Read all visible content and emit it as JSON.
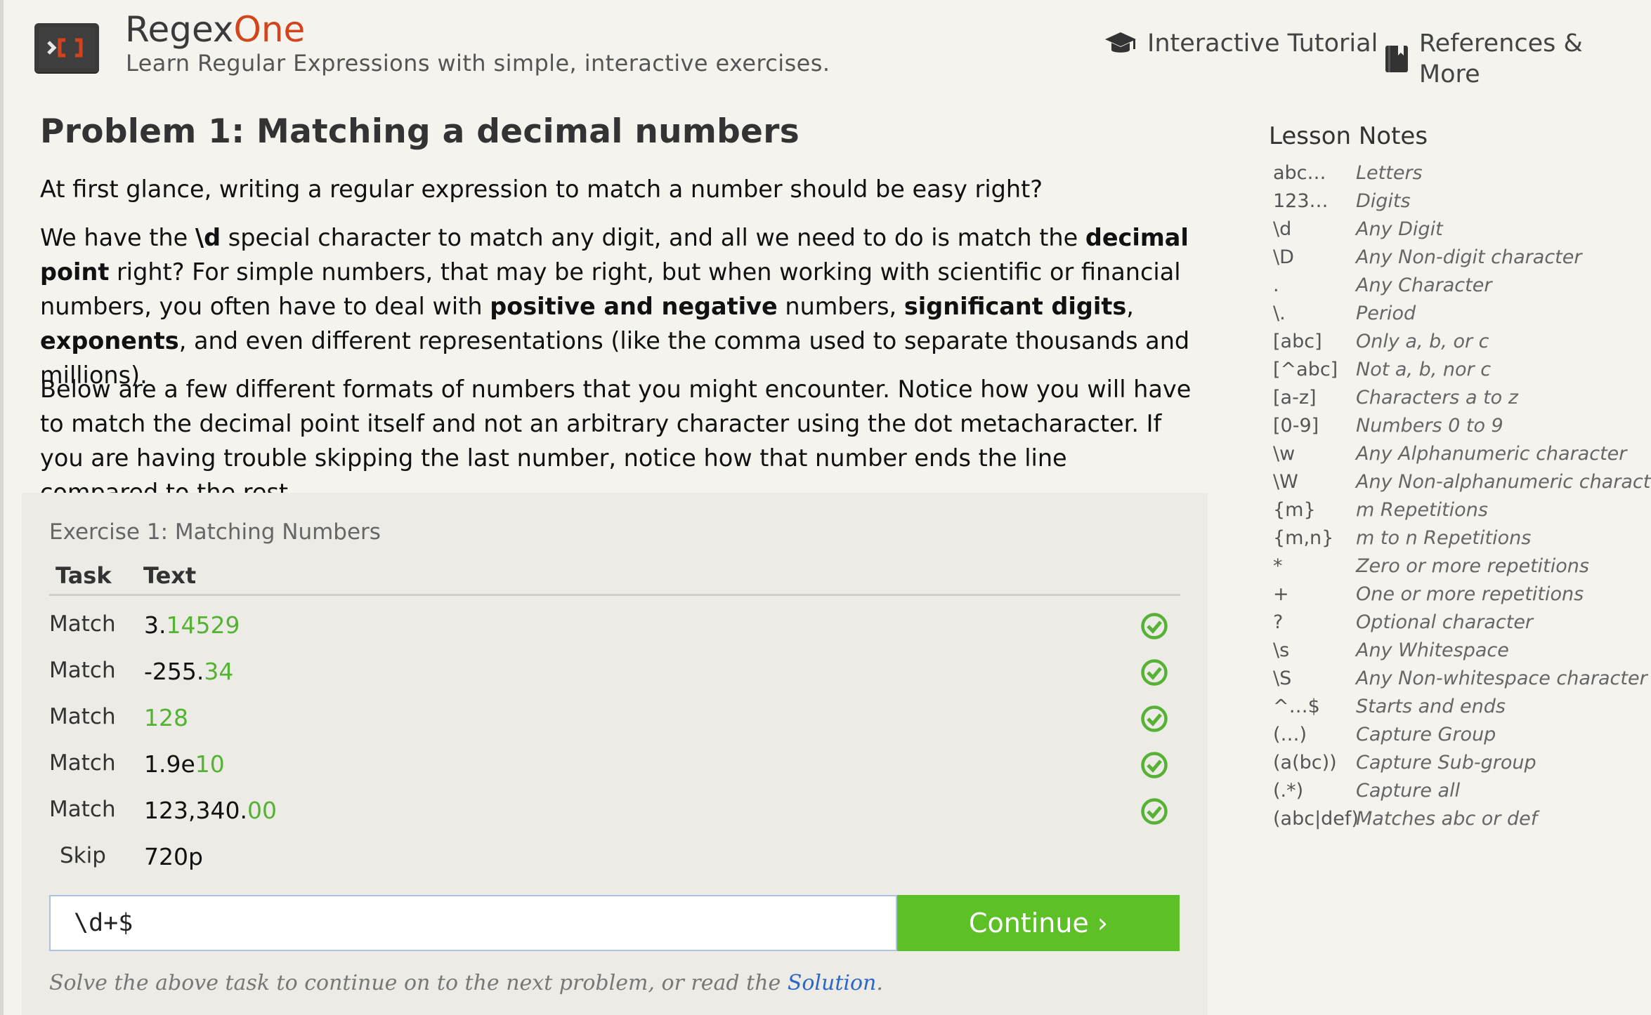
{
  "header": {
    "brand_main": "Regex",
    "brand_accent": "One",
    "tagline": "Learn Regular Expressions with simple, interactive exercises.",
    "nav": [
      {
        "label": "Interactive Tutorial",
        "icon": "graduation-cap-icon"
      },
      {
        "label": "References & More",
        "icon": "book-icon"
      }
    ]
  },
  "main": {
    "title": "Problem 1: Matching a decimal numbers",
    "paragraph1": "At first glance, writing a regular expression to match a number should be easy right?",
    "paragraph2": {
      "t1": "We have the ",
      "b1": "\\d",
      "t2": " special character to match any digit, and all we need to do is match the ",
      "b2": "decimal point",
      "t3": " right? For simple numbers, that may be right, but when working with scientific or financial numbers, you often have to deal with ",
      "b3": "positive and negative",
      "t4": " numbers, ",
      "b4": "significant digits",
      "t5": ", ",
      "b5": "exponents",
      "t6": ", and even different representations (like the comma used to separate thousands and millions)."
    },
    "paragraph3": "Below are a few different formats of numbers that you might encounter. Notice how you will have to match the decimal point itself and not an arbitrary character using the dot metacharacter. If you are having trouble skipping the last number, notice how that number ends the line compared to the rest."
  },
  "exercise": {
    "title": "Exercise 1: Matching Numbers",
    "col_task": "Task",
    "col_text": "Text",
    "rows": [
      {
        "task": "Match",
        "plain": "3.",
        "highlight": "14529",
        "status": "check-circle-icon"
      },
      {
        "task": "Match",
        "plain": "-255.",
        "highlight": "34",
        "status": "check-circle-icon"
      },
      {
        "task": "Match",
        "plain": "",
        "highlight": "128",
        "status": "check-circle-icon"
      },
      {
        "task": "Match",
        "plain": "1.9e",
        "highlight": "10",
        "status": "check-circle-icon"
      },
      {
        "task": "Match",
        "plain": "123,340.",
        "highlight": "00",
        "status": "check-circle-icon"
      },
      {
        "task": "Skip",
        "plain": "720p",
        "highlight": "",
        "status": ""
      }
    ],
    "input_value": "\\d+$",
    "continue_label": "Continue ›",
    "footnote_text": "Solve the above task to continue on to the next problem, or read the ",
    "footnote_link": "Solution",
    "footnote_end": ".",
    "colors": {
      "match_highlight": "#55b234",
      "button": "#5cc026",
      "link": "#2b67c6",
      "brand_accent": "#d4441c"
    }
  },
  "lesson_notes": {
    "title": "Lesson Notes",
    "items": [
      {
        "key": "abc…",
        "desc": "Letters"
      },
      {
        "key": "123…",
        "desc": "Digits"
      },
      {
        "key": "\\d",
        "desc": "Any Digit"
      },
      {
        "key": "\\D",
        "desc": "Any Non-digit character"
      },
      {
        "key": ".",
        "desc": "Any Character"
      },
      {
        "key": "\\.",
        "desc": "Period"
      },
      {
        "key": "[abc]",
        "desc": "Only a, b, or c"
      },
      {
        "key": "[^abc]",
        "desc": "Not a, b, nor c"
      },
      {
        "key": "[a-z]",
        "desc": "Characters a to z"
      },
      {
        "key": "[0-9]",
        "desc": "Numbers 0 to 9"
      },
      {
        "key": "\\w",
        "desc": "Any Alphanumeric character"
      },
      {
        "key": "\\W",
        "desc": "Any Non-alphanumeric character"
      },
      {
        "key": "{m}",
        "desc": "m Repetitions"
      },
      {
        "key": "{m,n}",
        "desc": "m to n Repetitions"
      },
      {
        "key": "*",
        "desc": "Zero or more repetitions"
      },
      {
        "key": "+",
        "desc": "One or more repetitions"
      },
      {
        "key": "?",
        "desc": "Optional character"
      },
      {
        "key": "\\s",
        "desc": "Any Whitespace"
      },
      {
        "key": "\\S",
        "desc": "Any Non-whitespace character"
      },
      {
        "key": "^…$",
        "desc": "Starts and ends"
      },
      {
        "key": "(…)",
        "desc": "Capture Group"
      },
      {
        "key": "(a(bc))",
        "desc": "Capture Sub-group"
      },
      {
        "key": "(.*)",
        "desc": "Capture all"
      },
      {
        "key": "(abc|def)",
        "desc": "Matches abc or def"
      }
    ]
  }
}
